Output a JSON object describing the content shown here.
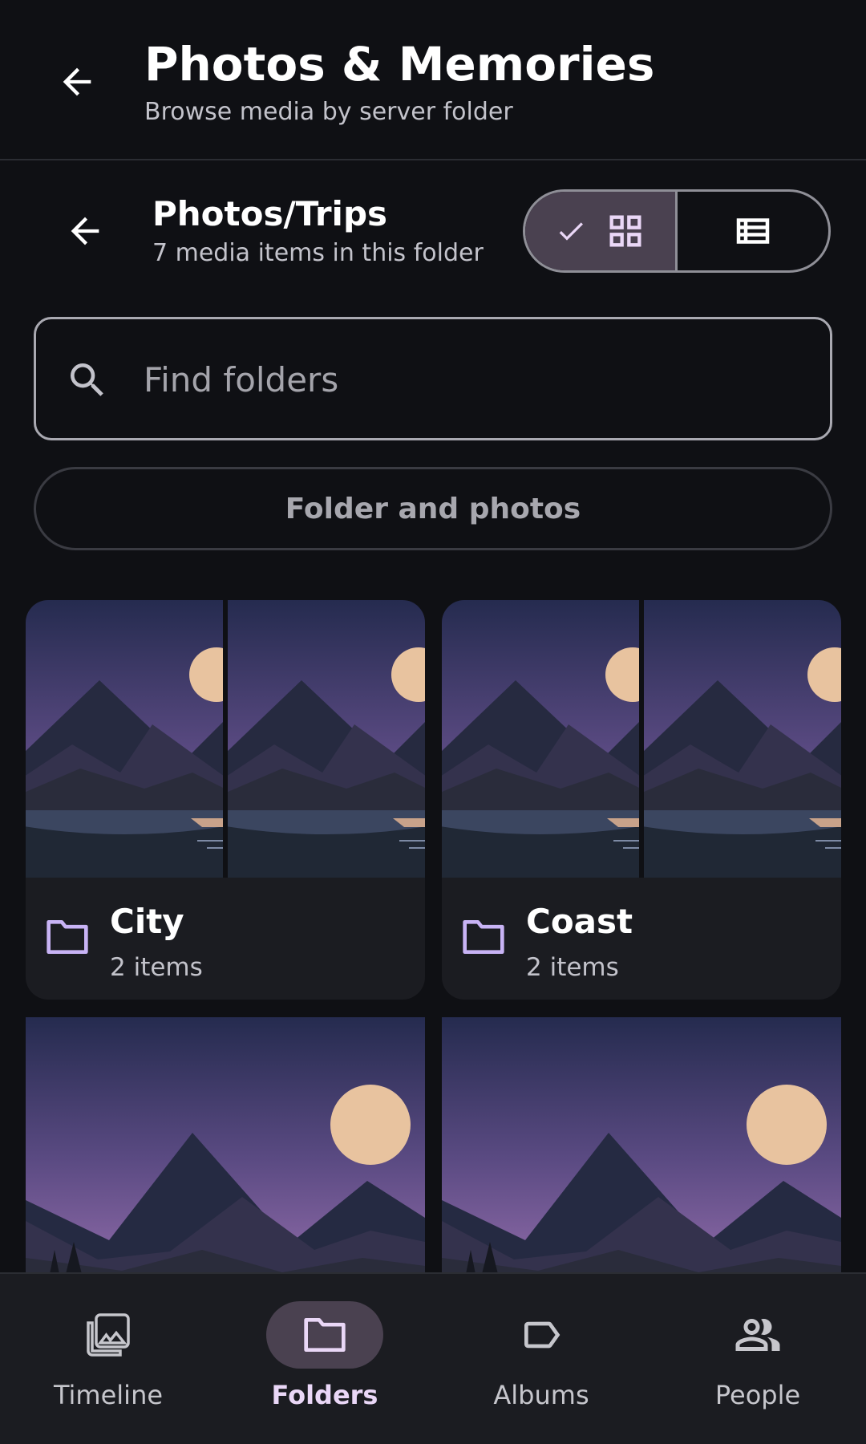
{
  "appbar": {
    "title": "Photos & Memories",
    "subtitle": "Browse media by server folder"
  },
  "folder": {
    "path": "Photos/Trips",
    "count_text": "7 media items in this folder",
    "view_mode": "grid"
  },
  "search": {
    "placeholder": "Find folders",
    "value": ""
  },
  "filter": {
    "label": "Folder and photos"
  },
  "folders": [
    {
      "name": "City",
      "items": "2 items"
    },
    {
      "name": "Coast",
      "items": "2 items"
    }
  ],
  "nav": {
    "items": [
      {
        "label": "Timeline",
        "icon": "timeline-icon"
      },
      {
        "label": "Folders",
        "icon": "folder-icon",
        "active": true
      },
      {
        "label": "Albums",
        "icon": "label-icon"
      },
      {
        "label": "People",
        "icon": "people-icon"
      }
    ]
  },
  "colors": {
    "background": "#0f1014",
    "surface": "#1b1c21",
    "accent": "#ead7f7",
    "accent_container": "#4a4150",
    "folder_icon": "#c8b3f5"
  }
}
